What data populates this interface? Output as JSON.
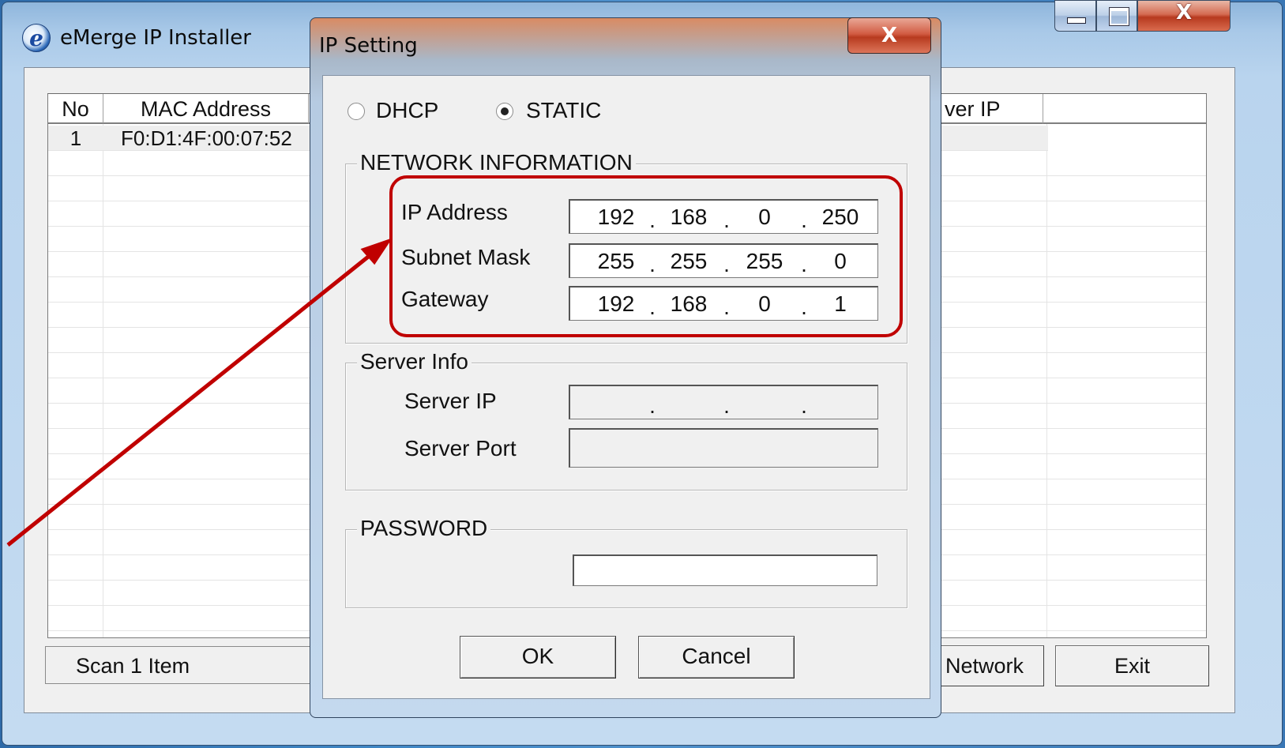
{
  "main_window": {
    "title": "eMerge IP Installer",
    "icon": "e-logo-icon",
    "caption_buttons": {
      "minimize": "minimize-icon",
      "maximize": "maximize-icon",
      "close": "X"
    }
  },
  "device_list": {
    "columns": [
      "No",
      "MAC Address",
      "ver IP",
      ""
    ],
    "rows": [
      {
        "no": "1",
        "mac": "F0:D1:4F:00:07:52"
      }
    ]
  },
  "status": {
    "scan_text": "Scan 1 Item"
  },
  "buttons": {
    "network": "Network",
    "exit": "Exit"
  },
  "dialog": {
    "title": "IP Setting",
    "close_label": "X",
    "mode": {
      "dhcp_label": "DHCP",
      "static_label": "STATIC",
      "selected": "STATIC"
    },
    "network_information": {
      "group_title": "NETWORK INFORMATION",
      "ip_address": {
        "label": "IP Address",
        "octets": [
          "192",
          "168",
          "0",
          "250"
        ]
      },
      "subnet_mask": {
        "label": "Subnet Mask",
        "octets": [
          "255",
          "255",
          "255",
          "0"
        ]
      },
      "gateway": {
        "label": "Gateway",
        "octets": [
          "192",
          "168",
          "0",
          "1"
        ]
      },
      "separator": "."
    },
    "server_info": {
      "group_title": "Server Info",
      "server_ip_label": "Server IP",
      "server_port_label": "Server Port",
      "server_port_value": ""
    },
    "password": {
      "group_title": "PASSWORD",
      "value": ""
    },
    "ok_label": "OK",
    "cancel_label": "Cancel"
  },
  "annotation": {
    "highlight_color": "#c00000"
  }
}
